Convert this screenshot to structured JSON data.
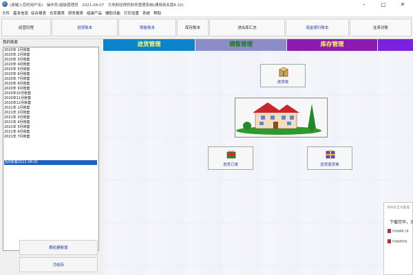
{
  "window": {
    "title": "(请输入您的用户名)　操作员:超级管理员　2021-08-07　大地财经俾药财务管理系统(通用商业版8.10)",
    "controls": [
      "–",
      "▢",
      "✕"
    ]
  },
  "menu": [
    "文件",
    "基本信息",
    "综合报表",
    "仓库报表",
    "财务报表",
    "组装产品",
    "辅助功能",
    "打印设置",
    "系统",
    "帮助"
  ],
  "toolbar": [
    "经营历程",
    "进货账本",
    "销售账本",
    "库存账本",
    "进出库汇总",
    "现金银行账本",
    "往来对账"
  ],
  "left": {
    "header": "我的账套",
    "accounts": [
      "2020年 1月账套",
      "2020年 2月账套",
      "2020年 3月账套",
      "2020年 4月账套",
      "2020年 5月账套",
      "2020年 6月账套",
      "2020年 7月账套",
      "2020年 8月账套",
      "2020年 9月账套",
      "2020年10月账套",
      "2020年11月账套",
      "2020年12月账套",
      "2021年 1月账套",
      "2021年 2月账套",
      "2021年 3月账套",
      "2021年 4月账套",
      "2021年 5月账套",
      "2021年 6月账套",
      "2021年 7月账套",
      "当前账套2021-08-01"
    ],
    "selected_index": 19,
    "buttons": [
      "期初建账套",
      "月结存"
    ]
  },
  "tabs": [
    {
      "label": "进货管理",
      "color": "#0b84cc",
      "text_color": "#ffff66"
    },
    {
      "label": "销售管理",
      "color": "#8c8cc8",
      "text_color": "#1a7a1a"
    },
    {
      "label": "库存管理",
      "color": "#8c1bb0",
      "text_color": "#ffff66"
    },
    {
      "label": "",
      "color": "#7a22e0",
      "text_color": "#ffffff"
    }
  ],
  "cards": {
    "purchase_form": "进货单",
    "purchase_order": "进货订单",
    "purchase_return": "进货退货单"
  },
  "colors": {
    "accent": "#1a3aa8",
    "selection": "#2060c0"
  },
  "popup": {
    "header": "360安全大脑提",
    "body": "下载完毕，3",
    "files": [
      "maokk.ra",
      "maoems"
    ]
  }
}
